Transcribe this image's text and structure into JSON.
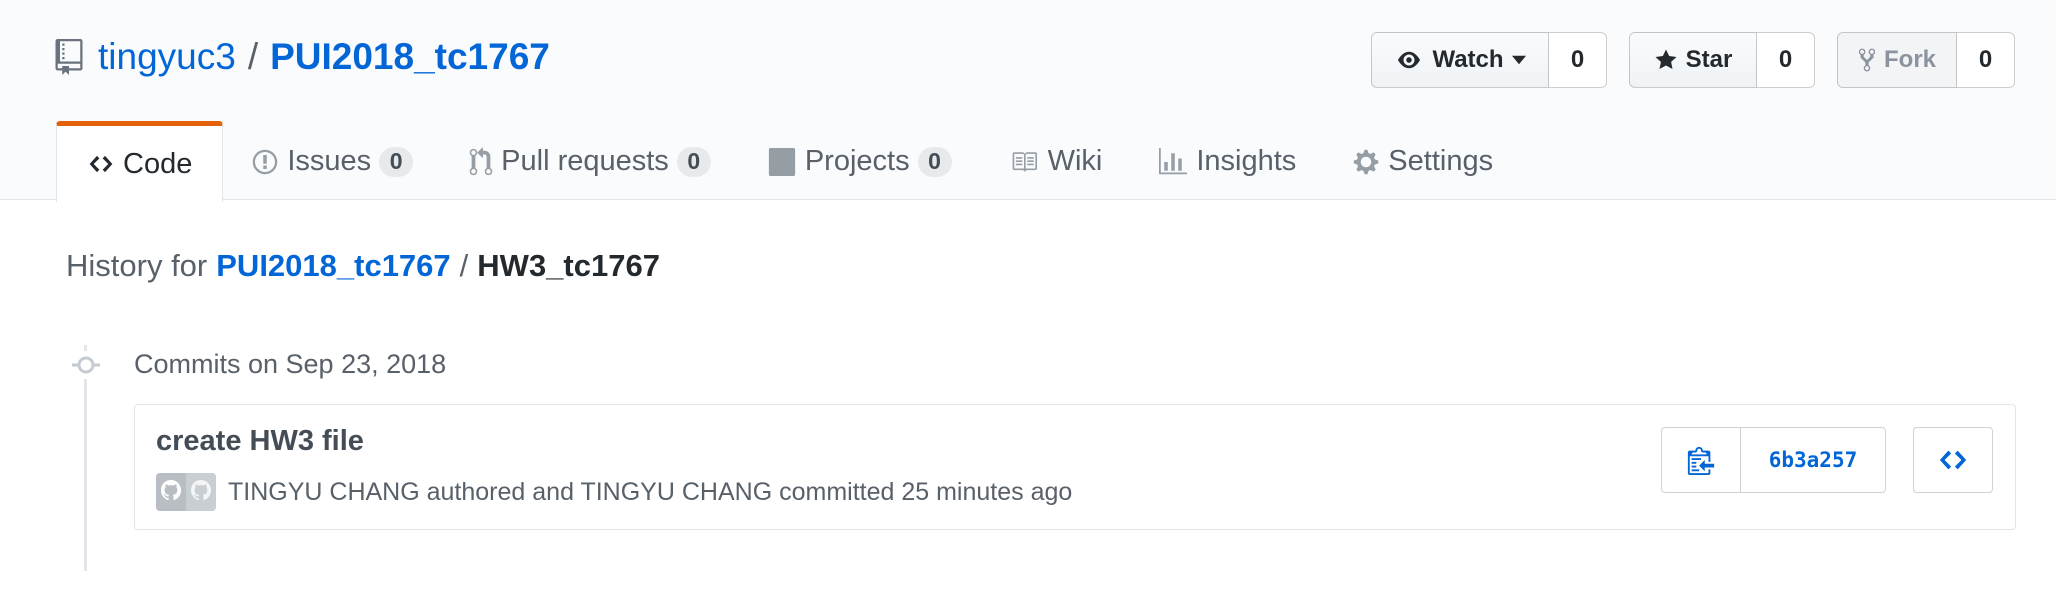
{
  "repo": {
    "owner": "tingyuc3",
    "separator": "/",
    "name": "PUI2018_tc1767"
  },
  "actions": {
    "watch": {
      "label": "Watch",
      "count": "0"
    },
    "star": {
      "label": "Star",
      "count": "0"
    },
    "fork": {
      "label": "Fork",
      "count": "0"
    }
  },
  "nav": {
    "code": {
      "label": "Code"
    },
    "issues": {
      "label": "Issues",
      "count": "0"
    },
    "pulls": {
      "label": "Pull requests",
      "count": "0"
    },
    "projects": {
      "label": "Projects",
      "count": "0"
    },
    "wiki": {
      "label": "Wiki"
    },
    "insights": {
      "label": "Insights"
    },
    "settings": {
      "label": "Settings"
    }
  },
  "history": {
    "prefix": "History for",
    "repo": "PUI2018_tc1767",
    "slash": "/",
    "path": "HW3_tc1767"
  },
  "commit_group": {
    "title": "Commits on Sep 23, 2018"
  },
  "commit": {
    "message": "create HW3 file",
    "meta": "TINGYU CHANG authored and TINGYU CHANG committed 25 minutes ago",
    "sha": "6b3a257"
  },
  "colors": {
    "link": "#0366d6",
    "selected_tab_border": "#e36209",
    "muted_text": "#586069"
  },
  "icons": [
    "repo-icon",
    "eye-icon",
    "caret-down-icon",
    "star-icon",
    "fork-icon",
    "code-icon",
    "issue-icon",
    "pull-request-icon",
    "project-icon",
    "wiki-book-icon",
    "graph-icon",
    "gear-icon",
    "commit-dot-icon",
    "clipboard-icon",
    "browse-code-icon"
  ]
}
